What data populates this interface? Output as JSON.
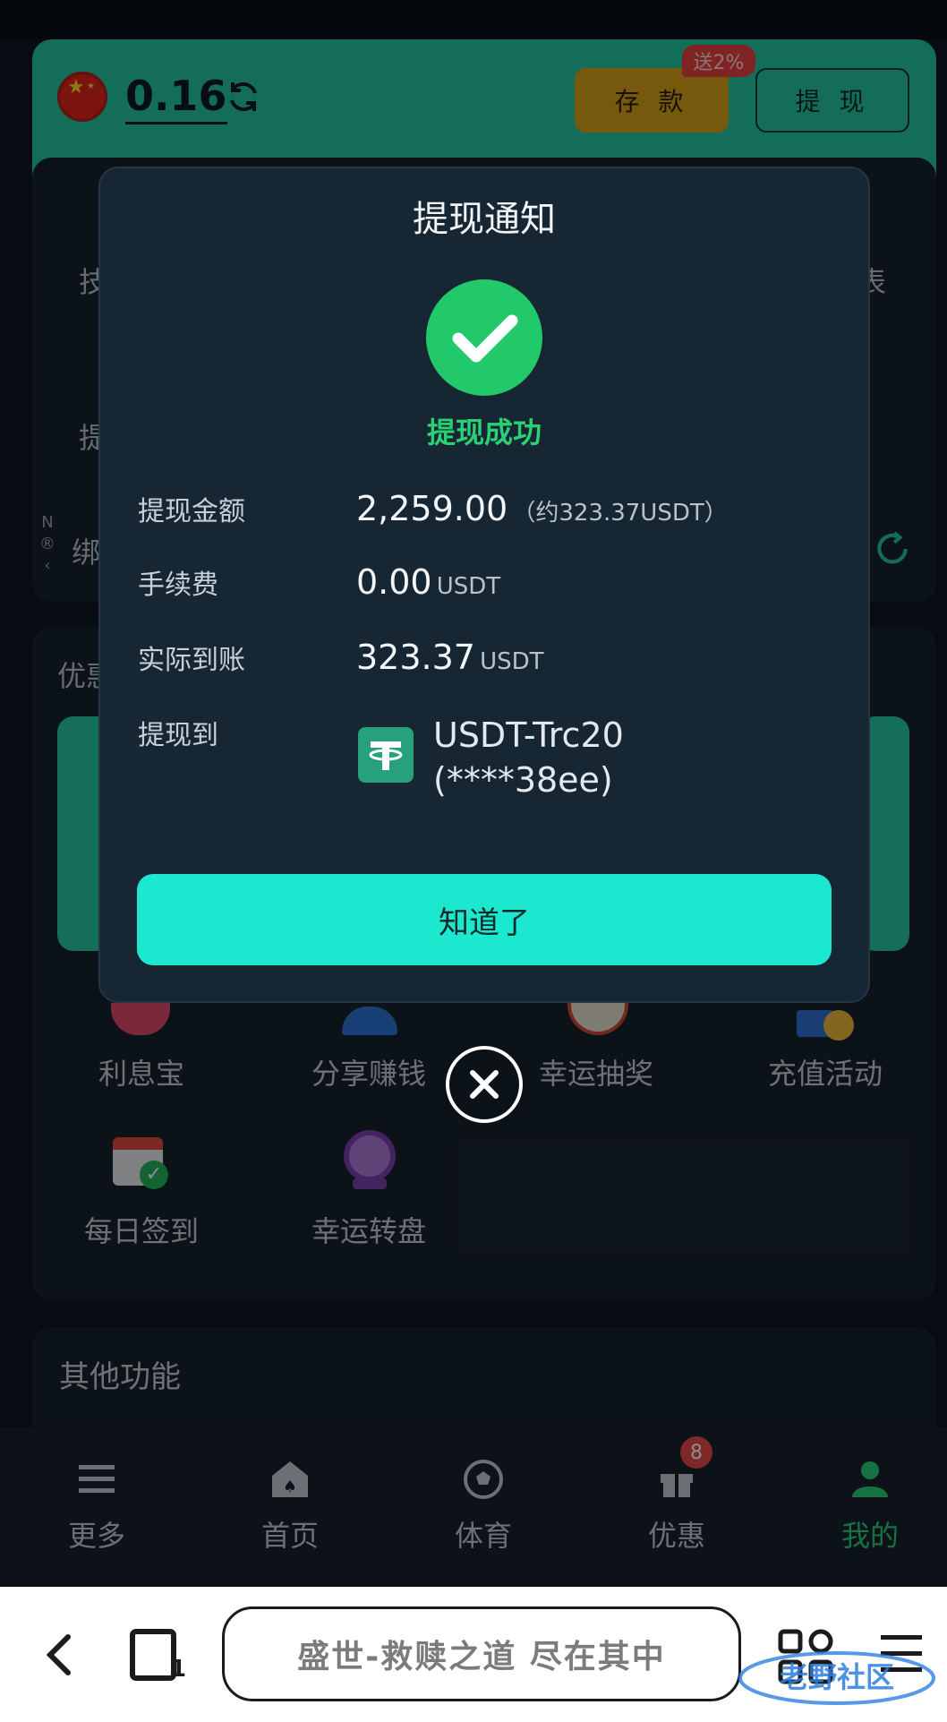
{
  "account": {
    "balance": "0.16",
    "deposit_label": "存 款",
    "deposit_bonus": "送2%",
    "withdraw_label": "提 现"
  },
  "background": {
    "row1_left": "技",
    "row1_right": "表",
    "row2_left": "提",
    "row3_left": "绑",
    "promo_title": "优惠",
    "features": [
      "利息宝",
      "分享赚钱",
      "幸运抽奖",
      "充值活动",
      "每日签到",
      "幸运转盘"
    ],
    "other_title": "其他功能"
  },
  "dialog": {
    "title": "提现通知",
    "status": "提现成功",
    "amount_label": "提现金额",
    "amount_value": "2,259.00",
    "amount_approx": "（约323.37USDT）",
    "fee_label": "手续费",
    "fee_value": "0.00",
    "fee_unit": "USDT",
    "received_label": "实际到账",
    "received_value": "323.37",
    "received_unit": "USDT",
    "dest_label": "提现到",
    "dest_name": "USDT-Trc20",
    "dest_account": "(****38ee)",
    "ok_label": "知道了"
  },
  "tabbar": {
    "items": [
      "更多",
      "首页",
      "体育",
      "优惠",
      "我的"
    ],
    "promo_badge": "8",
    "active_color": "#27d07a"
  },
  "browser": {
    "url_text": "盛世-救赎之道 尽在其中"
  },
  "colors": {
    "accent": "#26c6a0",
    "success": "#22c96a",
    "button": "#1ce8cf",
    "deposit": "#d9a31a"
  }
}
